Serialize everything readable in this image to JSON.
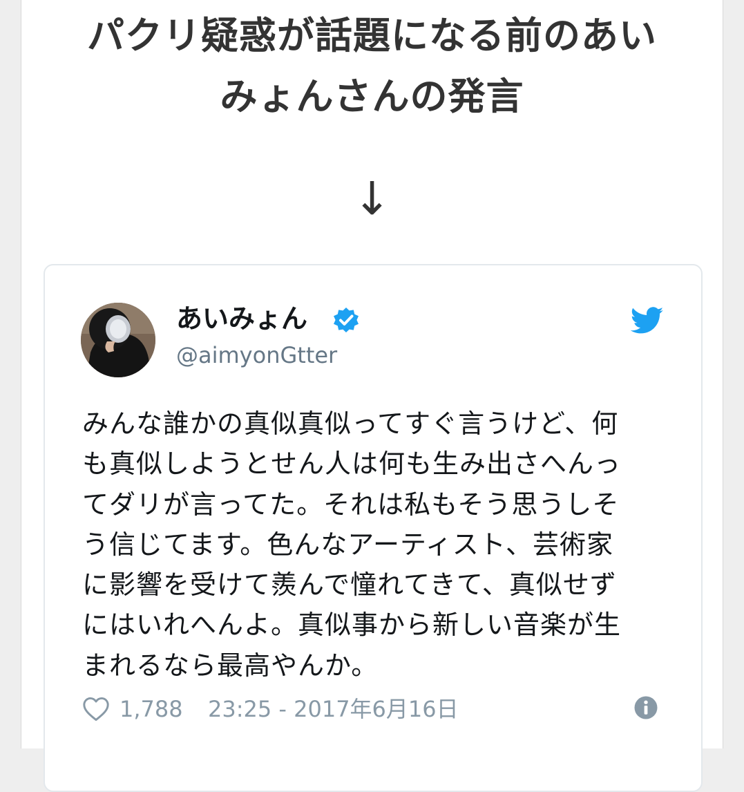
{
  "headline": {
    "line1": "パクリ疑惑が話題になる前のあい",
    "line2": "みょんさんの発言"
  },
  "arrow_glyph": "↓",
  "tweet": {
    "display_name": "あいみょん",
    "handle": "@aimyonGtter",
    "text_lines": [
      "みんな誰かの真似真似ってすぐ言うけど、何",
      "も真似しようとせん人は何も生み出さへんっ",
      "てダリが言ってた。それは私もそう思うしそ",
      "う信じてます。色んなアーティスト、芸術家",
      "に影響を受けて羨んで憧れてきて、真似せず",
      "にはいれへんよ。真似事から新しい音楽が生",
      "まれるなら最高やんか。"
    ],
    "like_count": "1,788",
    "timestamp": "23:25 - 2017年6月16日",
    "icons": {
      "verified": "verified-badge-icon",
      "brand": "twitter-bird-icon",
      "like": "heart-outline-icon",
      "info": "info-icon"
    }
  },
  "colors": {
    "verified_blue": "#1da1f2",
    "twitter_blue": "#1da1f2",
    "meta_gray": "#8899a6",
    "headline_text": "#333333"
  }
}
